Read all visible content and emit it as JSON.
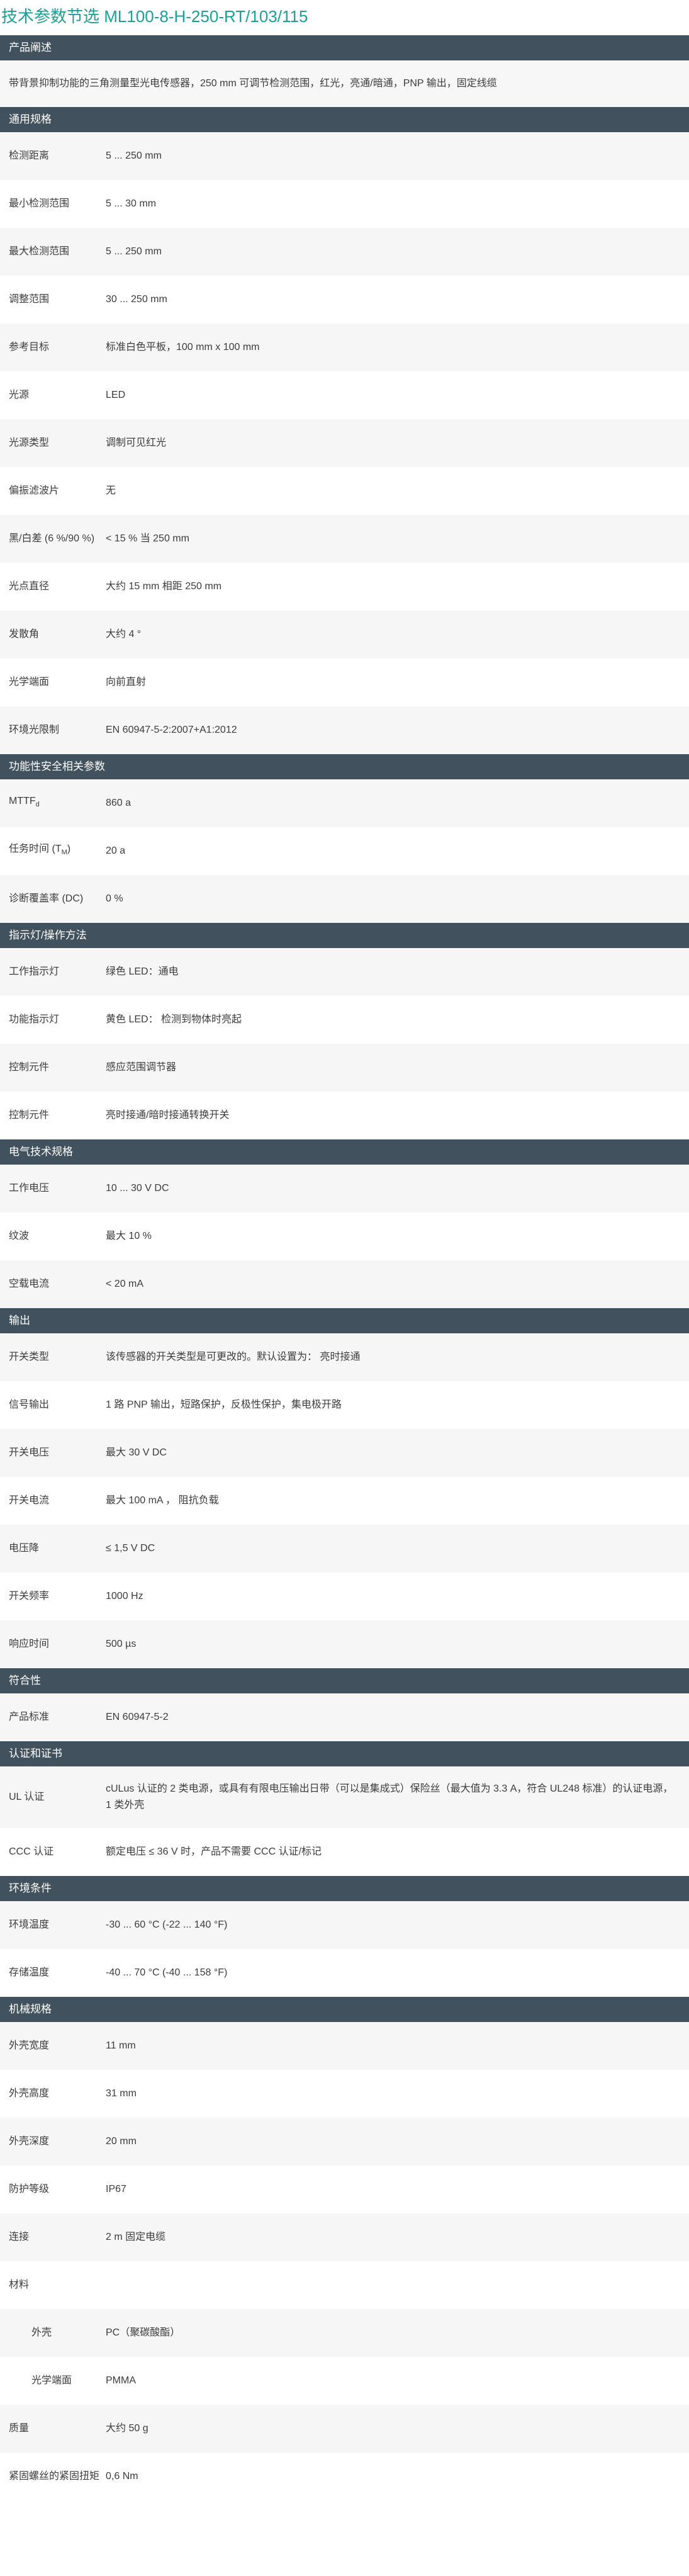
{
  "title": "技术参数节选  ML100-8-H-250-RT/103/115",
  "sections": {
    "product_desc": {
      "header": "产品阐述",
      "text": "带背景抑制功能的三角测量型光电传感器，250 mm 可调节检测范围，红光，亮通/暗通，PNP 输出，固定线缆"
    },
    "general": {
      "header": "通用规格",
      "rows": [
        {
          "label": "检测距离",
          "value": "5 ... 250 mm"
        },
        {
          "label": "最小检测范围",
          "value": "5 ... 30 mm"
        },
        {
          "label": "最大检测范围",
          "value": "5 ... 250 mm"
        },
        {
          "label": "调整范围",
          "value": "30 ... 250 mm"
        },
        {
          "label": "参考目标",
          "value": "标准白色平板，100 mm x 100 mm"
        },
        {
          "label": "光源",
          "value": "LED"
        },
        {
          "label": "光源类型",
          "value": "调制可见红光"
        },
        {
          "label": "偏振滤波片",
          "value": "无"
        },
        {
          "label": "黑/白差 (6 %/90 %)",
          "value": "< 15 % 当 250 mm"
        },
        {
          "label": "光点直径",
          "value": "大约 15 mm 相距 250 mm"
        },
        {
          "label": "发散角",
          "value": "大约 4 °"
        },
        {
          "label": "光学端面",
          "value": "向前直射"
        },
        {
          "label": "环境光限制",
          "value": "EN 60947-5-2:2007+A1:2012"
        }
      ]
    },
    "safety": {
      "header": "功能性安全相关参数",
      "rows": [
        {
          "label_main": "MTTF",
          "label_sub": "d",
          "value": "860 a"
        },
        {
          "label_main": "任务时间 (T",
          "label_sub": "M",
          "label_tail": ")",
          "value": "20 a"
        },
        {
          "label_main": "诊断覆盖率 (DC)",
          "value": "0 %"
        }
      ]
    },
    "indicators": {
      "header": "指示灯/操作方法",
      "rows": [
        {
          "label": "工作指示灯",
          "value": "绿色 LED：通电"
        },
        {
          "label": "功能指示灯",
          "value": "黄色 LED： 检测到物体时亮起"
        },
        {
          "label": "控制元件",
          "value": "感应范围调节器"
        },
        {
          "label": "控制元件",
          "value": "亮时接通/暗时接通转换开关"
        }
      ]
    },
    "electrical": {
      "header": "电气技术规格",
      "rows": [
        {
          "label": "工作电压",
          "value": "10 ... 30 V DC"
        },
        {
          "label": "纹波",
          "value": "最大 10 %"
        },
        {
          "label": "空载电流",
          "value": "< 20 mA"
        }
      ]
    },
    "output": {
      "header": "输出",
      "rows": [
        {
          "label": "开关类型",
          "value": "该传感器的开关类型是可更改的。默认设置为： 亮时接通"
        },
        {
          "label": "信号输出",
          "value": "1 路 PNP 输出，短路保护，反极性保护，集电极开路"
        },
        {
          "label": "开关电压",
          "value": "最大 30 V DC"
        },
        {
          "label": "开关电流",
          "value": "最大 100 mA ， 阻抗负载"
        },
        {
          "label": "电压降",
          "value": "≤ 1,5 V DC"
        },
        {
          "label": "开关频率",
          "value": "1000 Hz"
        },
        {
          "label": "响应时间",
          "value": "500 µs"
        }
      ]
    },
    "conformity": {
      "header": "符合性",
      "rows": [
        {
          "label": "产品标准",
          "value": "EN 60947-5-2"
        }
      ]
    },
    "approvals": {
      "header": "认证和证书",
      "rows": [
        {
          "label": "UL 认证",
          "value": "cULus 认证的 2 类电源，或具有有限电压输出日带（可以是集成式）保险丝（最大值为 3.3 A，符合 UL248 标准）的认证电源，1 类外壳"
        },
        {
          "label": "CCC 认证",
          "value": "额定电压 ≤ 36 V 时，产品不需要 CCC 认证/标记"
        }
      ]
    },
    "ambient": {
      "header": "环境条件",
      "rows": [
        {
          "label": "环境温度",
          "value": "-30 ... 60 °C (-22 ... 140 °F)"
        },
        {
          "label": "存储温度",
          "value": "-40 ... 70 °C (-40 ... 158 °F)"
        }
      ]
    },
    "mechanical": {
      "header": "机械规格",
      "rows": [
        {
          "label": "外壳宽度",
          "value": "11 mm"
        },
        {
          "label": "外壳高度",
          "value": "31 mm"
        },
        {
          "label": "外壳深度",
          "value": "20 mm"
        },
        {
          "label": "防护等级",
          "value": "IP67"
        },
        {
          "label": "连接",
          "value": "2 m 固定电缆"
        },
        {
          "label": "材料",
          "value": ""
        },
        {
          "label": "外壳",
          "value": "PC（聚碳酸酯）"
        },
        {
          "label": "光学端面",
          "value": "PMMA"
        },
        {
          "label": "质量",
          "value": "大约 50 g"
        },
        {
          "label": "紧固螺丝的紧固扭矩",
          "value": "0,6 Nm"
        }
      ]
    }
  }
}
